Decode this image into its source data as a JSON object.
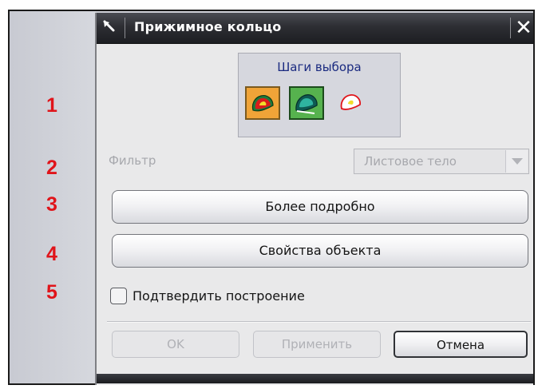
{
  "dialog": {
    "title": "Прижимное кольцо",
    "close_symbol": "✕"
  },
  "annotations": [
    "1",
    "2",
    "3",
    "4",
    "5"
  ],
  "selection_steps": {
    "label": "Шаги выбора",
    "steps": [
      {
        "icon": "sheet-body-icon",
        "state": "active"
      },
      {
        "icon": "sheet-body-green-icon",
        "state": "active"
      },
      {
        "icon": "sheet-outline-icon",
        "state": "inactive"
      }
    ]
  },
  "filter": {
    "label": "Фильтр",
    "value": "Листовое тело",
    "enabled": false
  },
  "buttons": {
    "more_details": "Более подробно",
    "object_properties": "Свойства объекта",
    "ok": "OK",
    "apply": "Применить",
    "cancel": "Отмена"
  },
  "confirm_build": {
    "label": "Подтвердить построение",
    "checked": false
  },
  "colors": {
    "title_bar": "#2d2e33",
    "annotation": "#e0141a",
    "steps_label": "#1a2a80",
    "disabled_text": "#a7a8ad"
  }
}
